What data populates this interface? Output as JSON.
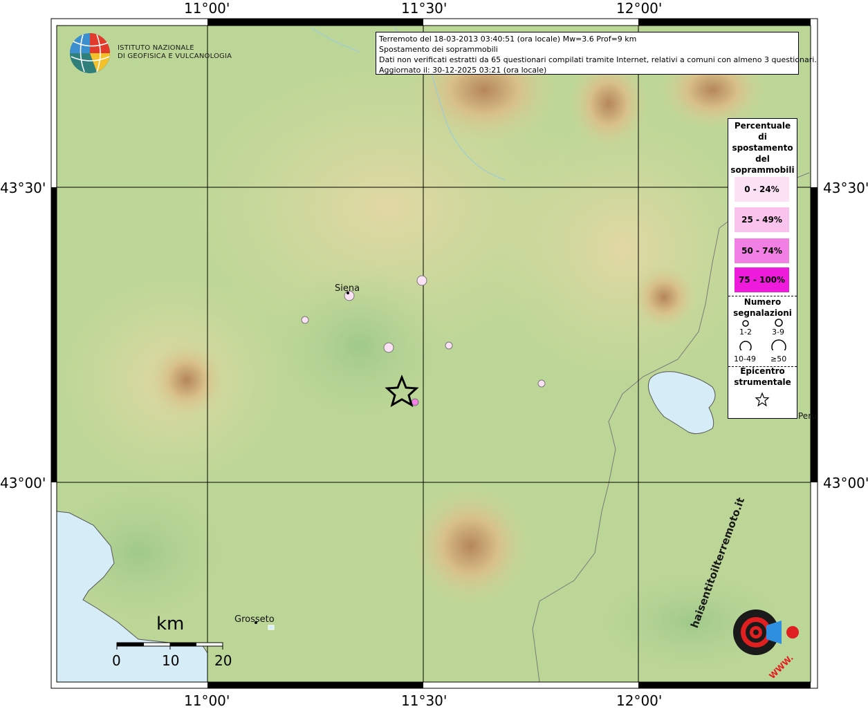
{
  "map": {
    "lon_ticks": [
      "11°00'",
      "11°30'",
      "12°00'"
    ],
    "lat_ticks": [
      "43°30'",
      "43°00'"
    ]
  },
  "logo": {
    "line1": "ISTITUTO NAZIONALE",
    "line2": "DI GEOFISICA E VULCANOLOGIA"
  },
  "info": {
    "line1": "Terremoto del 18-03-2013 03:40:51 (ora locale) Mw=3.6 Prof=9 km",
    "line2": "Spostamento dei soprammobili",
    "line3": "Dati non verificati estratti da 65 questionari compilati tramite Internet, relativi a comuni con almeno 3 questionari.",
    "line4": "Aggiornato il: 30-12-2025 03:21 (ora locale)"
  },
  "legend": {
    "title_lines": [
      "Percentuale",
      "di",
      "spostamento",
      "del",
      "soprammobili"
    ],
    "classes": [
      {
        "label": "0 - 24%",
        "color": "#fde2f6"
      },
      {
        "label": "25 - 49%",
        "color": "#f9c3ee"
      },
      {
        "label": "50 - 74%",
        "color": "#f27fe4"
      },
      {
        "label": "75 - 100%",
        "color": "#ee1bdc"
      }
    ],
    "count_title_1": "Numero",
    "count_title_2": "segnalazioni",
    "count_labels": [
      "1-2",
      "3-9",
      "10-49",
      "≥50"
    ],
    "epi_title_1": "Epicentro",
    "epi_title_2": "strumentale"
  },
  "cities": {
    "siena": "Siena",
    "grosseto": "Grosseto",
    "perugia_fragment": "Peru"
  },
  "scale": {
    "unit": "km",
    "labels": [
      "0",
      "10",
      "20"
    ]
  },
  "brand": {
    "circle_text": "haisentitoilterremoto.it",
    "www": "WWW."
  },
  "observations": [
    {
      "place": "Siena",
      "class": "0 - 24%",
      "count": "3-9"
    },
    {
      "place": "",
      "class": "0 - 24%",
      "count": "3-9"
    },
    {
      "place": "",
      "class": "0 - 24%",
      "count": "1-2"
    },
    {
      "place": "",
      "class": "0 - 24%",
      "count": "3-9"
    },
    {
      "place": "",
      "class": "0 - 24%",
      "count": "1-2"
    },
    {
      "place": "",
      "class": "0 - 24%",
      "count": "1-2"
    },
    {
      "place": "",
      "class": "50 - 74%",
      "count": "1-2"
    }
  ]
}
